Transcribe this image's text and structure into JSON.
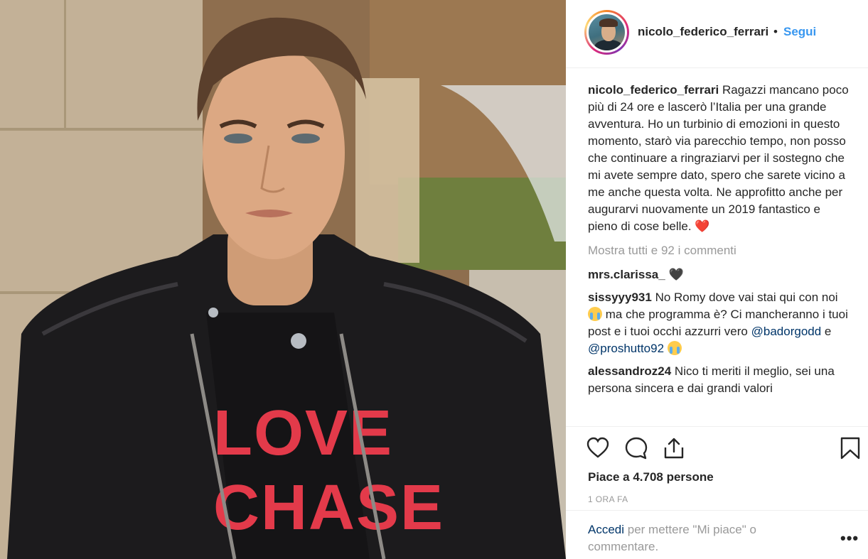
{
  "post": {
    "username": "nicolo_federico_ferrari",
    "separator": "•",
    "follow_label": "Segui",
    "caption_text": "Ragazzi mancano poco più di 24 ore e lascerò l’Italia per una grande avventura. Ho un turbinio di emozioni in questo momento, starò via parecchio tempo, non posso che continuare a ringraziarvi per il sostegno che mi avete sempre dato, spero che sarete vicino a me anche questa volta. Ne approfitto anche per augurarvi nuovamente un 2019 fantastico e pieno di cose belle.",
    "caption_emoji": "❤️",
    "photo_shirt_text_1": "LOVE",
    "photo_shirt_text_2": "CHASE"
  },
  "view_all_comments": "Mostra tutti e 92 i commenti",
  "comments": [
    {
      "user": "mrs.clarissa_",
      "text": "🖤",
      "mentions": []
    },
    {
      "user": "sissyyy931",
      "text_1": "No Romy dove vai stai qui con noi",
      "text_2": "ma che programma è? Ci mancheranno i tuoi post e i tuoi occhi azzurri vero",
      "mention_1": "@badorgodd",
      "conj": "e",
      "mention_2": "@proshutto92"
    },
    {
      "user": "alessandroz24",
      "text": "Nico ti meriti il meglio, sei una persona sincera e dai grandi valori"
    }
  ],
  "actions": {
    "like_icon": "heart-outline-icon",
    "comment_icon": "speech-bubble-icon",
    "share_icon": "share-icon",
    "save_icon": "bookmark-icon"
  },
  "likes_text": "Piace a 4.708 persone",
  "timestamp": "1 ORA FA",
  "login_prompt": {
    "link": "Accedi",
    "text": "per mettere \"Mi piace\" o commentare."
  },
  "more_options": "•••"
}
